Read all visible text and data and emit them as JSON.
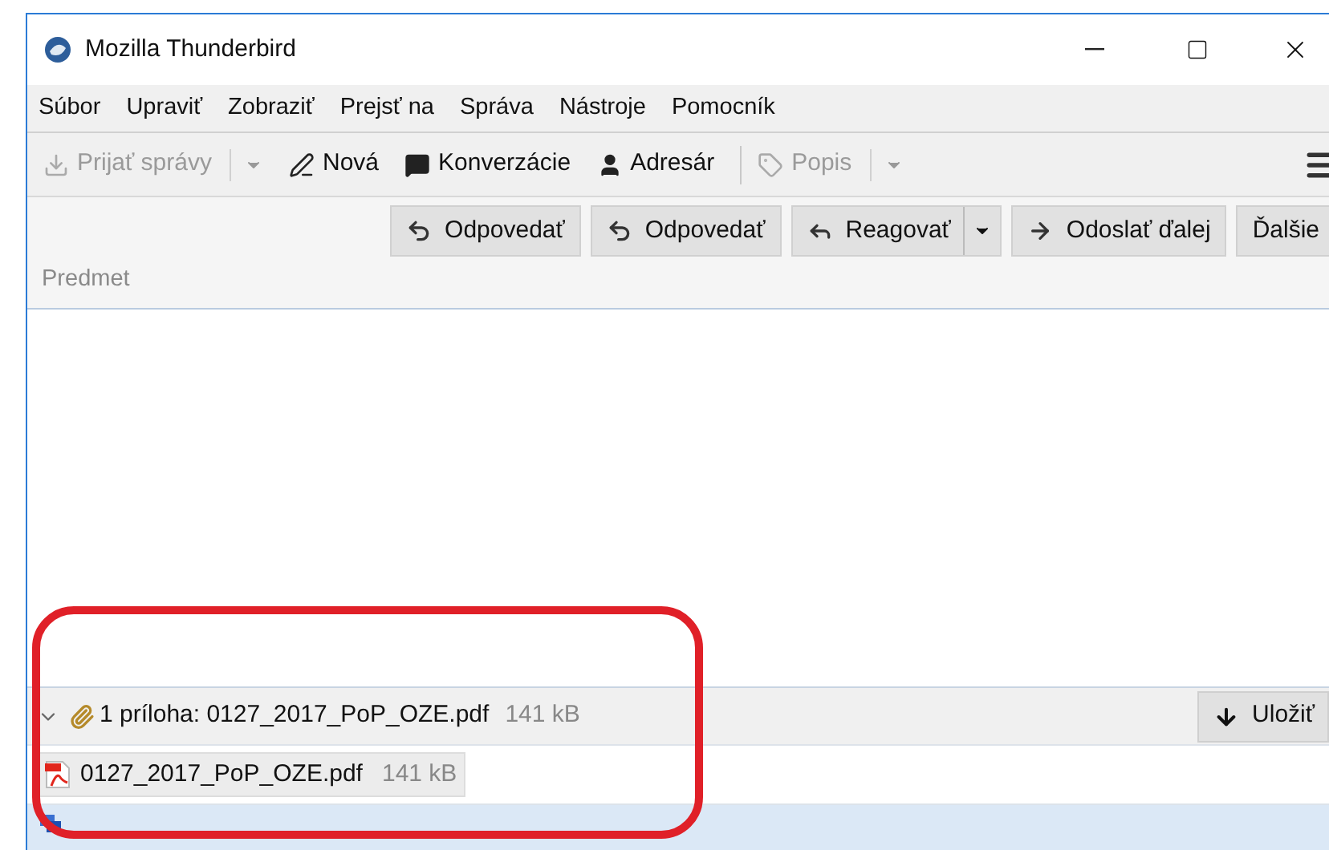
{
  "window": {
    "title": "Mozilla Thunderbird"
  },
  "menu": [
    "Súbor",
    "Upraviť",
    "Zobraziť",
    "Prejsť na",
    "Správa",
    "Nástroje",
    "Pomocník"
  ],
  "toolbar": [
    {
      "kind": "download",
      "label": "Prijať správy",
      "disabled": true,
      "dropdown": true
    },
    {
      "kind": "write",
      "label": "Nová",
      "disabled": false,
      "dropdown": false
    },
    {
      "kind": "chat",
      "label": "Konverzácie",
      "disabled": false,
      "dropdown": false
    },
    {
      "kind": "person",
      "label": "Adresár",
      "disabled": false,
      "dropdown": false
    },
    {
      "kind": "tag",
      "label": "Popis",
      "disabled": true,
      "dropdown": true
    }
  ],
  "header_buttons": [
    {
      "kind": "reply",
      "label": "Odpovedať",
      "dropdown": false
    },
    {
      "kind": "reply",
      "label": "Odpovedať",
      "dropdown": false
    },
    {
      "kind": "react",
      "label": "Reagovať",
      "dropdown": true
    },
    {
      "kind": "forward",
      "label": "Odoslať ďalej",
      "dropdown": false
    },
    {
      "kind": "none",
      "label": "Ďalšie",
      "dropdown": false
    }
  ],
  "subject_label": "Predmet",
  "attachments": {
    "expanded": true,
    "summary": "1 príloha: 0127_2017_PoP_OZE.pdf",
    "size": "141 kB",
    "save_button": "Uložiť",
    "items": [
      {
        "name": "0127_2017_PoP_OZE.pdf",
        "size": "141 kB"
      }
    ]
  },
  "annotation": {
    "kind": "highlight"
  }
}
